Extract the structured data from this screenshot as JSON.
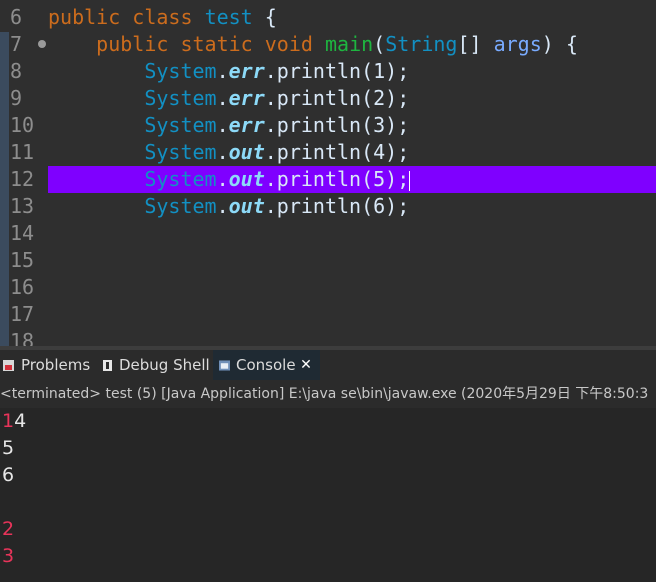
{
  "editor": {
    "line_numbers": [
      "6",
      "7",
      "8",
      "9",
      "10",
      "11",
      "12",
      "13",
      "14",
      "15",
      "16",
      "17",
      "18"
    ],
    "fold_marker_icon": "collapse-marker-icon",
    "lines": [
      {
        "kw1": "public",
        "kw2": "class",
        "name": "test",
        "brace": " {"
      },
      {
        "kw1": "public",
        "kw2": "static",
        "kw3": "void",
        "method": "main",
        "open": "(",
        "type": "String",
        "arr": "[] ",
        "param": "args",
        "close": ") {"
      },
      {
        "cls": "System",
        "dot1": ".",
        "field": "err",
        "dot2": ".",
        "call": "println(1);"
      },
      {
        "cls": "System",
        "dot1": ".",
        "field": "err",
        "dot2": ".",
        "call": "println(2);"
      },
      {
        "cls": "System",
        "dot1": ".",
        "field": "err",
        "dot2": ".",
        "call": "println(3);"
      },
      {
        "cls": "System",
        "dot1": ".",
        "field": "out",
        "dot2": ".",
        "call": "println(4);"
      },
      {
        "cls": "System",
        "dot1": ".",
        "field": "out",
        "dot2": ".",
        "call": "println(5);"
      },
      {
        "cls": "System",
        "dot1": ".",
        "field": "out",
        "dot2": ".",
        "call": "println(6);"
      }
    ],
    "highlight_color": "#7f00ff"
  },
  "views": {
    "tabs": [
      {
        "label": "Problems",
        "icon": "problems-icon"
      },
      {
        "label": "Debug Shell",
        "icon": "debug-shell-icon"
      },
      {
        "label": "Console",
        "icon": "console-icon",
        "active": true,
        "close": "✕"
      }
    ]
  },
  "console": {
    "status": "<terminated> test (5) [Java Application] E:\\java se\\bin\\javaw.exe (2020年5月29日 下午8:50:3",
    "line1_err": "1",
    "line1_out": "4",
    "line2_out": "5",
    "line3_out": "6",
    "line5_err": "2",
    "line6_err": "3",
    "colors": {
      "stderr": "#e8345a",
      "stdout": "#e6e6e6"
    }
  }
}
